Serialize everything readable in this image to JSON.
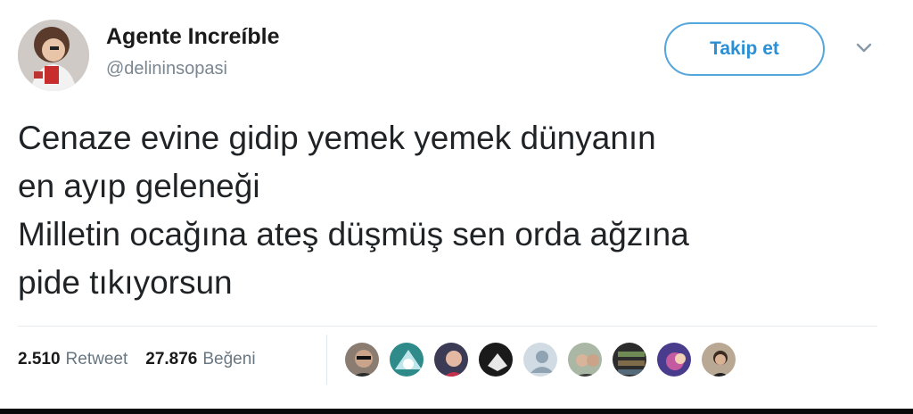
{
  "user": {
    "name": "Agente Increíble",
    "handle": "@delininsopasi"
  },
  "actions": {
    "follow_label": "Takip et",
    "more_icon": "chevron-down-icon"
  },
  "tweet": {
    "lines": [
      "Cenaze evine gidip yemek yemek dünyanın",
      "en ayıp geleneği",
      "Milletin ocağına ateş düşmüş sen orda ağzına",
      "pide tıkıyorsun"
    ]
  },
  "stats": {
    "retweets": "2.510",
    "retweets_label": "Retweet",
    "likes": "27.876",
    "likes_label": "Beğeni"
  },
  "colors": {
    "accent": "#1da1f2",
    "muted": "#687782"
  }
}
